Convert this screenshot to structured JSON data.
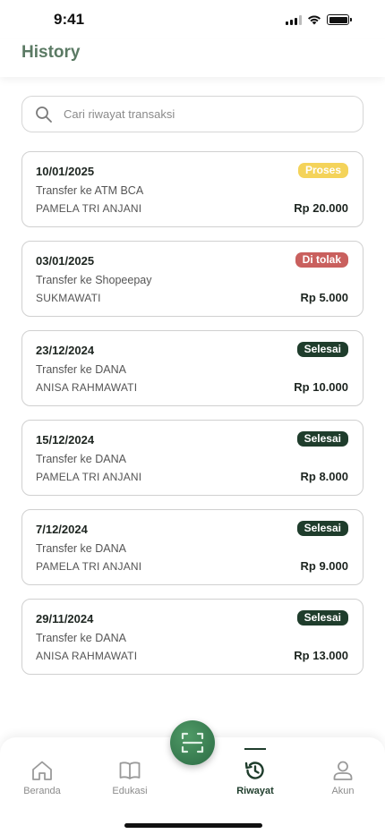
{
  "status_bar": {
    "time": "9:41"
  },
  "header": {
    "title": "History"
  },
  "search": {
    "placeholder": "Cari riwayat transaksi"
  },
  "transactions": [
    {
      "date": "10/01/2025",
      "description": "Transfer ke ATM BCA",
      "recipient": "PAMELA TRI ANJANI",
      "amount": "Rp 20.000",
      "status": "Proses",
      "status_color": "#f4d35a"
    },
    {
      "date": "03/01/2025",
      "description": "Transfer ke Shopeepay",
      "recipient": "SUKMAWATI",
      "amount": "Rp 5.000",
      "status": "Di tolak",
      "status_color": "#c9605e"
    },
    {
      "date": "23/12/2024",
      "description": "Transfer ke DANA",
      "recipient": "ANISA RAHMAWATI",
      "amount": "Rp 10.000",
      "status": "Selesai",
      "status_color": "#1f3d2c"
    },
    {
      "date": "15/12/2024",
      "description": "Transfer ke DANA",
      "recipient": "PAMELA TRI ANJANI",
      "amount": "Rp 8.000",
      "status": "Selesai",
      "status_color": "#1f3d2c"
    },
    {
      "date": "7/12/2024",
      "description": "Transfer ke DANA",
      "recipient": "PAMELA TRI ANJANI",
      "amount": "Rp 9.000",
      "status": "Selesai",
      "status_color": "#1f3d2c"
    },
    {
      "date": "29/11/2024",
      "description": "Transfer ke DANA",
      "recipient": "ANISA RAHMAWATI",
      "amount": "Rp 13.000",
      "status": "Selesai",
      "status_color": "#1f3d2c"
    }
  ],
  "bottom_nav": {
    "items": [
      {
        "label": "Beranda",
        "icon": "home-icon"
      },
      {
        "label": "Edukasi",
        "icon": "book-icon"
      },
      {
        "label": "Riwayat",
        "icon": "history-icon",
        "active": true
      },
      {
        "label": "Akun",
        "icon": "user-icon"
      }
    ],
    "scan_icon": "scan-icon"
  },
  "colors": {
    "title": "#5b7a64",
    "primary": "#1f3d2c",
    "scan_button": "#3e8757"
  }
}
